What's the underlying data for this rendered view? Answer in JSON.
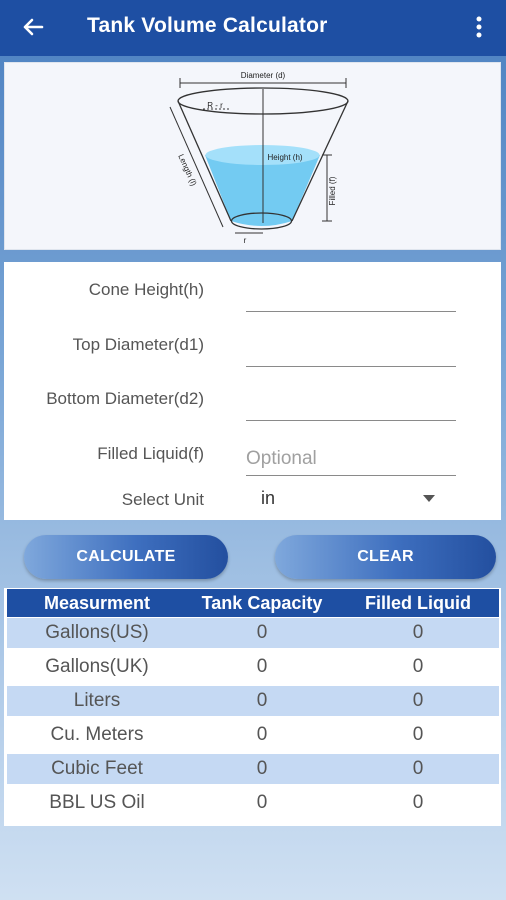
{
  "app": {
    "title": "Tank Volume Calculator"
  },
  "diagram": {
    "diameter_label": "Diameter (d)",
    "r_label": "R - r",
    "height_label": "Height (h)",
    "length_label": "Length (l)",
    "filled_label": "Filled (f)",
    "bottom_r_label": "r"
  },
  "form": {
    "cone_height": {
      "label": "Cone Height(h)",
      "value": "",
      "placeholder": ""
    },
    "top_diameter": {
      "label": "Top Diameter(d1)",
      "value": "",
      "placeholder": ""
    },
    "bottom_diameter": {
      "label": "Bottom Diameter(d2)",
      "value": "",
      "placeholder": ""
    },
    "filled_liquid": {
      "label": "Filled Liquid(f)",
      "value": "",
      "placeholder": "Optional"
    },
    "unit": {
      "label": "Select Unit",
      "value": "in"
    }
  },
  "buttons": {
    "calculate": "CALCULATE",
    "clear": "CLEAR"
  },
  "table": {
    "headers": [
      "Measurment",
      "Tank Capacity",
      "Filled Liquid"
    ],
    "rows": [
      {
        "name": "Gallons(US)",
        "capacity": "0",
        "filled": "0"
      },
      {
        "name": "Gallons(UK)",
        "capacity": "0",
        "filled": "0"
      },
      {
        "name": "Liters",
        "capacity": "0",
        "filled": "0"
      },
      {
        "name": "Cu. Meters",
        "capacity": "0",
        "filled": "0"
      },
      {
        "name": "Cubic Feet",
        "capacity": "0",
        "filled": "0"
      },
      {
        "name": "BBL US Oil",
        "capacity": "0",
        "filled": "0"
      }
    ]
  },
  "colors": {
    "appbar": "#1e4fa3",
    "row_alt": "#c5d9f3",
    "liquid": "#5cc3f0"
  },
  "icons": {
    "back": "arrow-left-icon",
    "menu": "more-vertical-icon",
    "dropdown": "caret-down-icon"
  }
}
